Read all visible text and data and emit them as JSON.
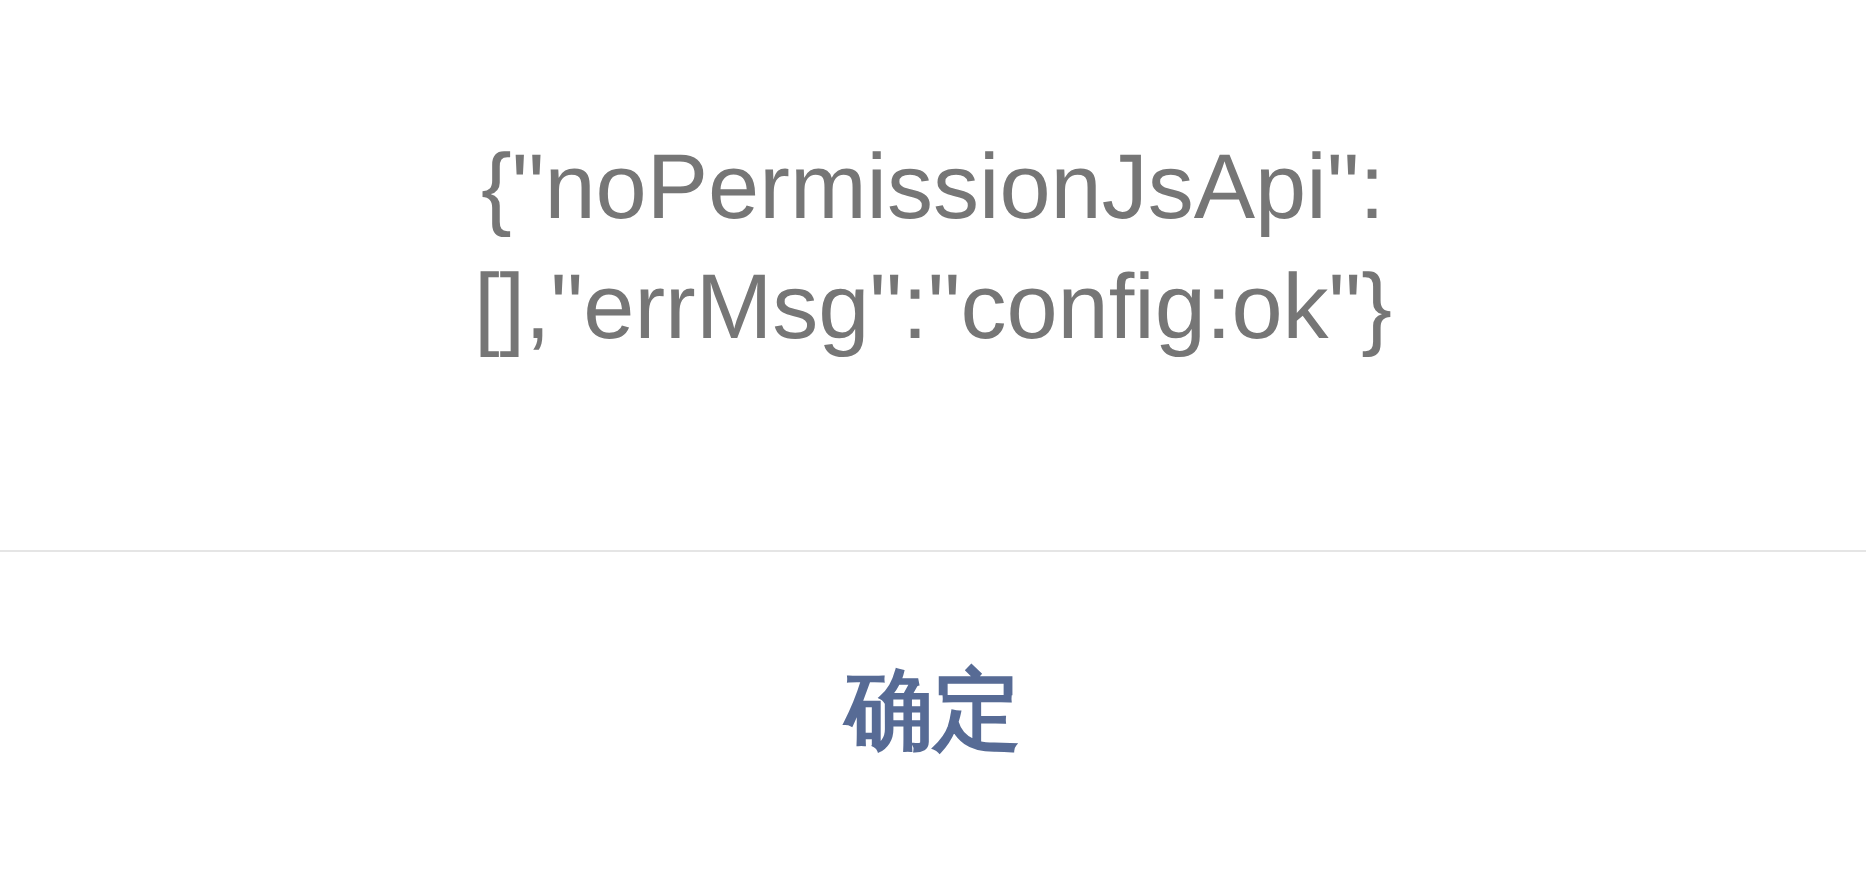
{
  "dialog": {
    "message": "{\"noPermissionJsApi\":[],\"errMsg\":\"config:ok\"}",
    "buttons": [
      {
        "label": "确定"
      }
    ]
  }
}
